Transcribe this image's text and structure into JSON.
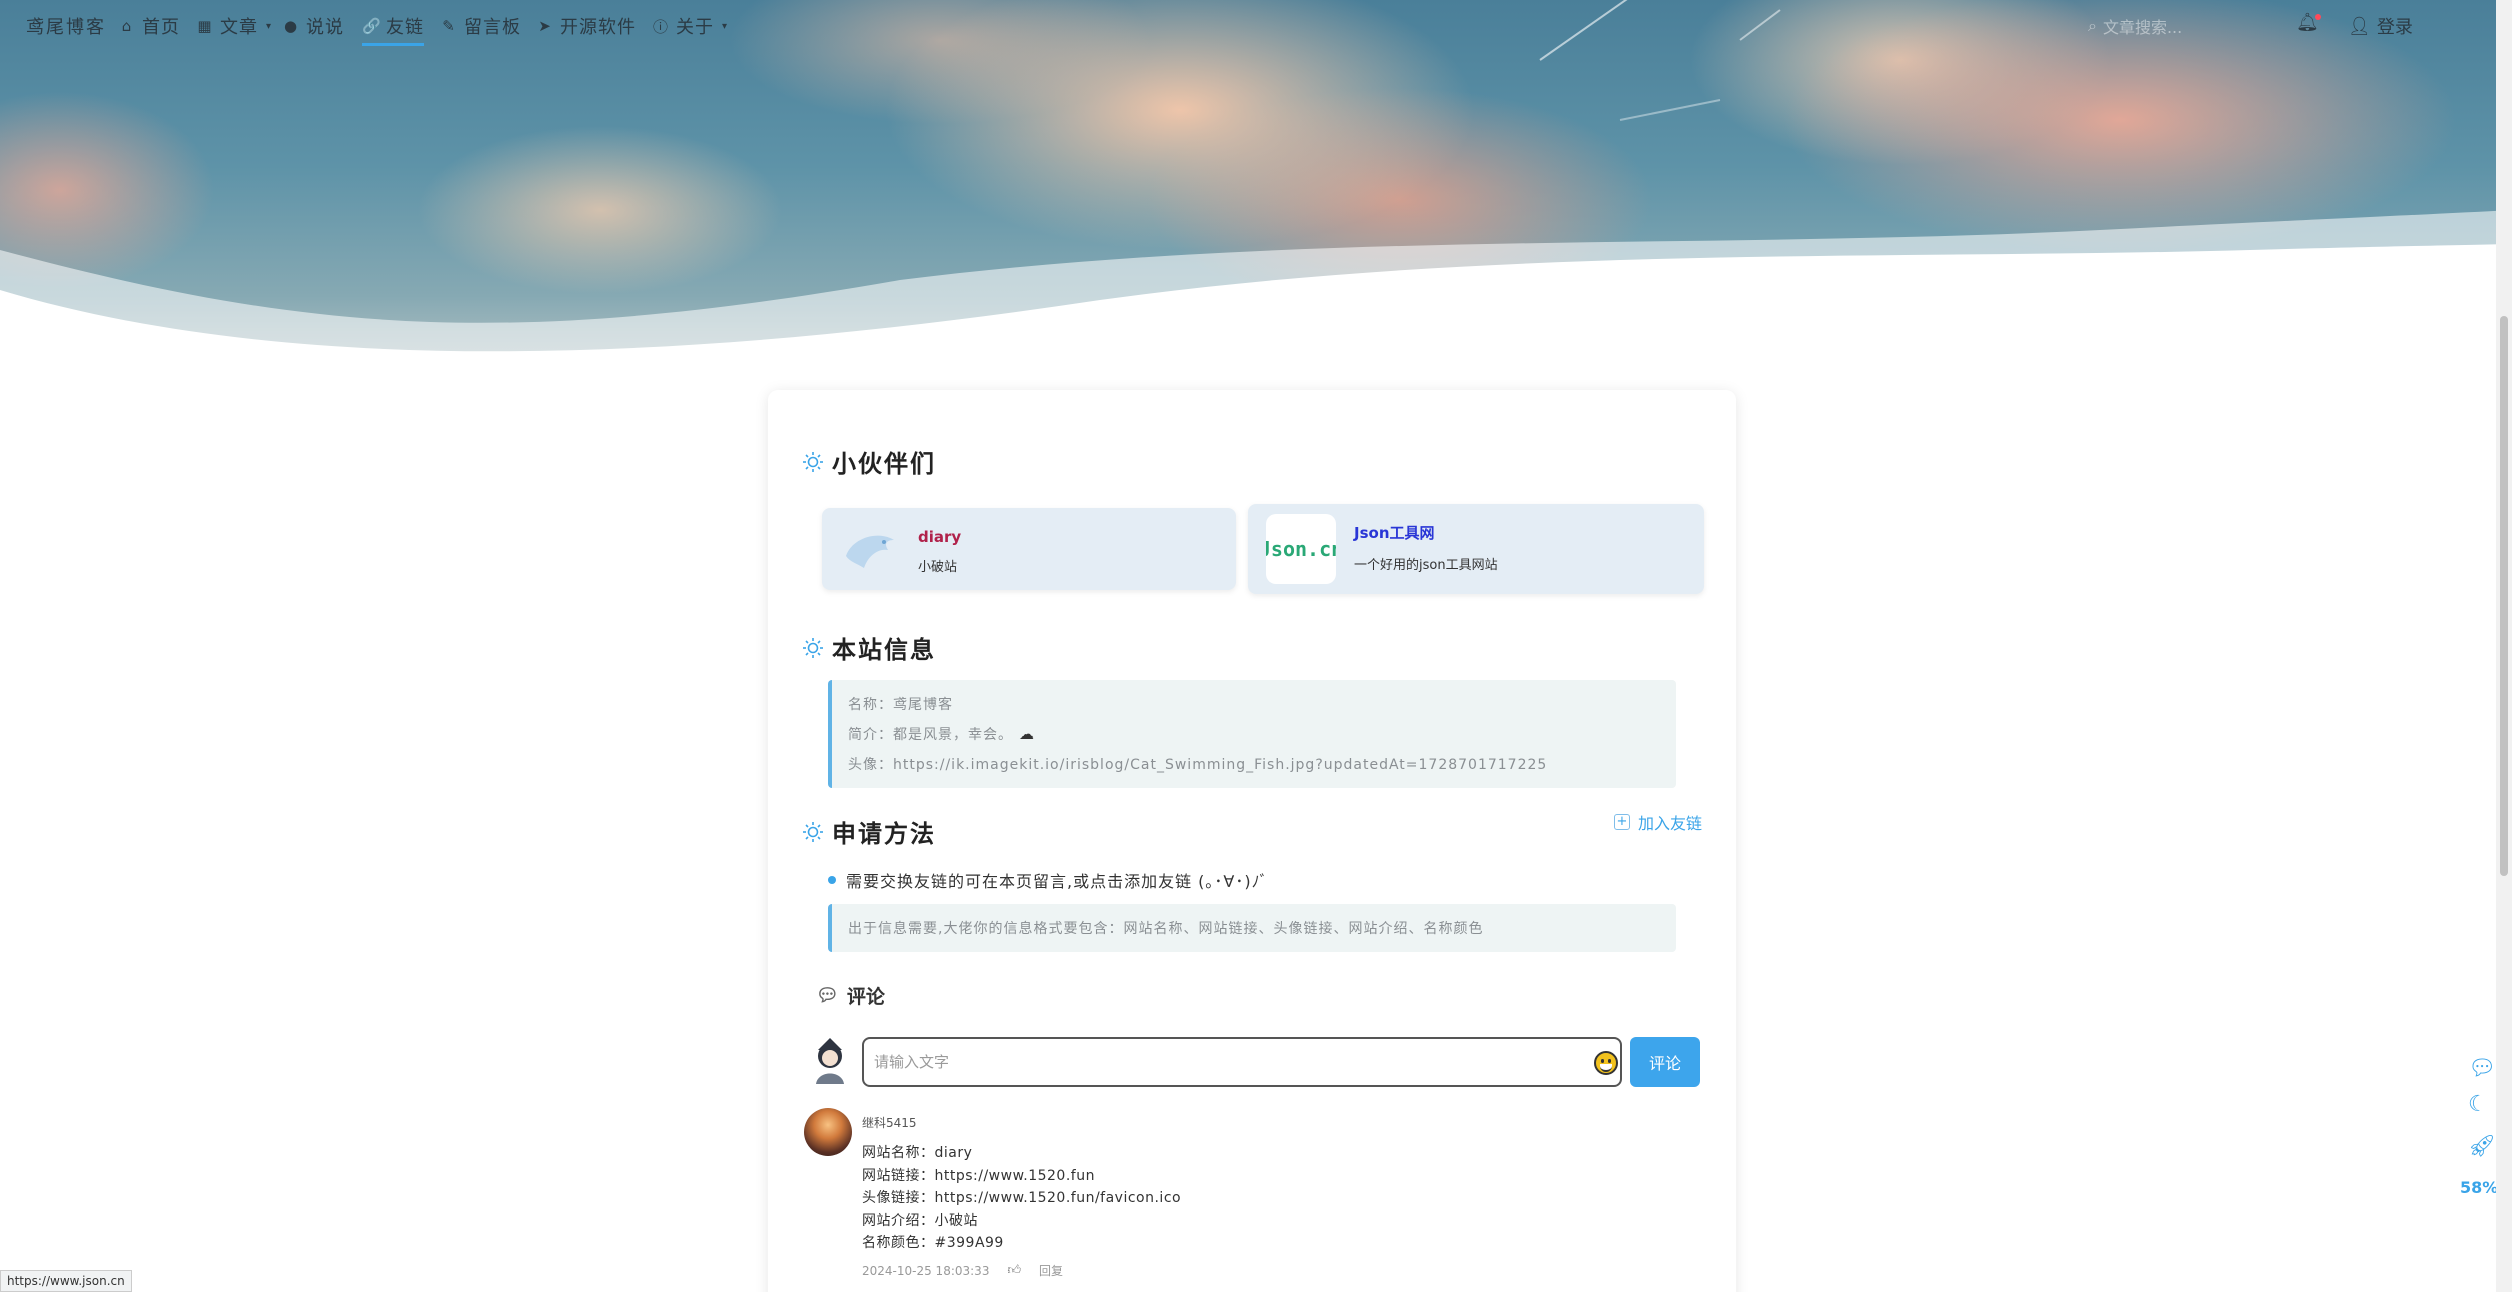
{
  "nav": {
    "brand": "鸢尾博客",
    "items": [
      {
        "label": "首页",
        "icon": "home-icon"
      },
      {
        "label": "文章",
        "icon": "grid-icon",
        "dropdown": true
      },
      {
        "label": "说说",
        "icon": "chat-icon"
      },
      {
        "label": "友链",
        "icon": "link-icon",
        "active": true
      },
      {
        "label": "留言板",
        "icon": "message-board-icon"
      },
      {
        "label": "开源软件",
        "icon": "send-icon"
      },
      {
        "label": "关于",
        "icon": "info-icon",
        "dropdown": true
      }
    ],
    "search_placeholder": "文章搜索...",
    "login": "登录"
  },
  "friends_section": {
    "title": "小伙伴们",
    "friends": [
      {
        "name": "diary",
        "desc": "小破站",
        "name_color": "#399A99"
      },
      {
        "name": "Json工具网",
        "desc": "一个好用的json工具网站",
        "logo_text": "Json.cn"
      }
    ]
  },
  "site_info": {
    "title": "本站信息",
    "name_line": "名称：鸢尾博客",
    "intro_line": "简介：都是风景，幸会。",
    "avatar_line": "头像：https://ik.imagekit.io/irisblog/Cat_Swimming_Fish.jpg?updatedAt=1728701717225"
  },
  "apply": {
    "title": "申请方法",
    "join_label": "加入友链",
    "bullet": "需要交换友链的可在本页留言,或点击添加友链 (｡･∀･)ﾉﾞ",
    "note": "出于信息需要,大佬你的信息格式要包含：网站名称、网站链接、头像链接、网站介绍、名称颜色"
  },
  "comments": {
    "title": "评论",
    "input_placeholder": "请输入文字",
    "submit": "评论",
    "items": [
      {
        "user": "继科5415",
        "lines": [
          "网站名称：diary",
          "网站链接：https://www.1520.fun",
          "头像链接：https://www.1520.fun/favicon.ico",
          "网站介绍：小破站",
          "名称颜色：#399A99"
        ],
        "time": "2024-10-25 18:03:33",
        "reply": "回复"
      }
    ]
  },
  "side_tools": {
    "percent": "58%"
  },
  "status_url": "https://www.json.cn",
  "colors": {
    "accent": "#3aa4e8",
    "friend_bg": "#e4edf5",
    "quote_border": "#60b3e6"
  }
}
